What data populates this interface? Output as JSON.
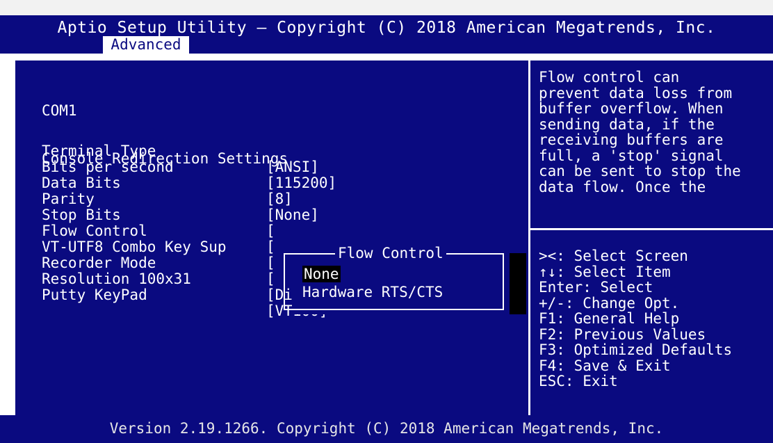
{
  "header": {
    "title": "Aptio Setup Utility – Copyright (C) 2018 American Megatrends, Inc.",
    "active_tab": "Advanced"
  },
  "section": {
    "line1": "COM1",
    "line2": "Console Redirection Settings"
  },
  "settings": [
    {
      "label": "Terminal Type",
      "value": "[ANSI]"
    },
    {
      "label": "Bits per second",
      "value": "[115200]"
    },
    {
      "label": "Data Bits",
      "value": "[8]"
    },
    {
      "label": "Parity",
      "value": "[None]"
    },
    {
      "label": "Stop Bits",
      "value": "["
    },
    {
      "label": "Flow Control",
      "value": "["
    },
    {
      "label": "VT-UTF8 Combo Key Sup",
      "value": "["
    },
    {
      "label": "Recorder Mode",
      "value": "["
    },
    {
      "label": "Resolution 100x31",
      "value": "[Di"
    },
    {
      "label": "Putty KeyPad",
      "value": "[VT100]"
    }
  ],
  "popup": {
    "title": "Flow Control",
    "options": [
      "None",
      "Hardware RTS/CTS"
    ],
    "selected_index": 0
  },
  "help": {
    "description": "Flow control can\nprevent data loss from\nbuffer overflow. When\nsending data, if the\nreceiving buffers are\nfull, a 'stop' signal\ncan be sent to stop the\ndata flow. Once the",
    "keys": [
      "><: Select Screen",
      "↑↓: Select Item",
      "Enter: Select",
      "+/-: Change Opt.",
      "F1: General Help",
      "F2: Previous Values",
      "F3: Optimized Defaults",
      "F4: Save & Exit",
      "ESC: Exit"
    ]
  },
  "footer": {
    "text": "Version 2.19.1266. Copyright (C) 2018 American Megatrends, Inc."
  },
  "colors": {
    "background_blue": "#0a0a80",
    "text": "#ffffff",
    "highlight": "#000000"
  }
}
